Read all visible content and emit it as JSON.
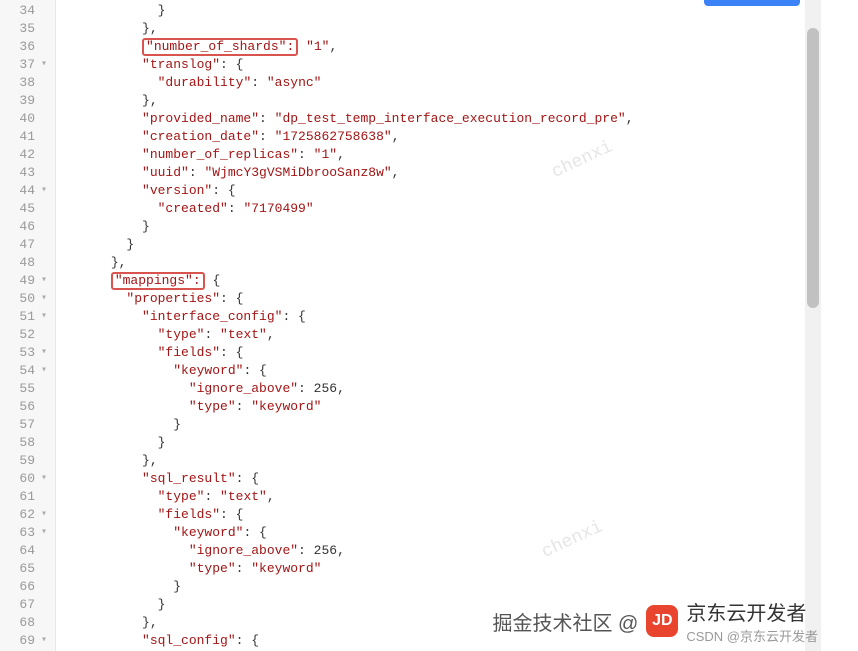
{
  "gutter": {
    "start": 34,
    "end": 69,
    "fold_lines": [
      37,
      44,
      49,
      50,
      51,
      53,
      54,
      60,
      62,
      63,
      69
    ]
  },
  "highlights": {
    "shards_key": "\"number_of_shards\":",
    "mappings_key": "\"mappings\":"
  },
  "code_lines": [
    {
      "n": 34,
      "indent": 12,
      "tokens": [
        {
          "t": "punc",
          "v": "}"
        }
      ]
    },
    {
      "n": 35,
      "indent": 10,
      "tokens": [
        {
          "t": "punc",
          "v": "},"
        }
      ]
    },
    {
      "n": 36,
      "indent": 10,
      "tokens": [
        {
          "t": "hl",
          "v": "\"number_of_shards\":"
        },
        {
          "t": "punc",
          "v": " "
        },
        {
          "t": "str",
          "v": "\"1\""
        },
        {
          "t": "punc",
          "v": ","
        }
      ]
    },
    {
      "n": 37,
      "indent": 10,
      "tokens": [
        {
          "t": "key",
          "v": "\"translog\""
        },
        {
          "t": "punc",
          "v": ": {"
        }
      ]
    },
    {
      "n": 38,
      "indent": 12,
      "tokens": [
        {
          "t": "key",
          "v": "\"durability\""
        },
        {
          "t": "punc",
          "v": ": "
        },
        {
          "t": "str",
          "v": "\"async\""
        }
      ]
    },
    {
      "n": 39,
      "indent": 10,
      "tokens": [
        {
          "t": "punc",
          "v": "},"
        }
      ]
    },
    {
      "n": 40,
      "indent": 10,
      "tokens": [
        {
          "t": "key",
          "v": "\"provided_name\""
        },
        {
          "t": "punc",
          "v": ": "
        },
        {
          "t": "str",
          "v": "\"dp_test_temp_interface_execution_record_pre\""
        },
        {
          "t": "punc",
          "v": ","
        }
      ]
    },
    {
      "n": 41,
      "indent": 10,
      "tokens": [
        {
          "t": "key",
          "v": "\"creation_date\""
        },
        {
          "t": "punc",
          "v": ": "
        },
        {
          "t": "str",
          "v": "\"1725862758638\""
        },
        {
          "t": "punc",
          "v": ","
        }
      ]
    },
    {
      "n": 42,
      "indent": 10,
      "tokens": [
        {
          "t": "key",
          "v": "\"number_of_replicas\""
        },
        {
          "t": "punc",
          "v": ": "
        },
        {
          "t": "str",
          "v": "\"1\""
        },
        {
          "t": "punc",
          "v": ","
        }
      ]
    },
    {
      "n": 43,
      "indent": 10,
      "tokens": [
        {
          "t": "key",
          "v": "\"uuid\""
        },
        {
          "t": "punc",
          "v": ": "
        },
        {
          "t": "str",
          "v": "\"WjmcY3gVSMiDbrooSanz8w\""
        },
        {
          "t": "punc",
          "v": ","
        }
      ]
    },
    {
      "n": 44,
      "indent": 10,
      "tokens": [
        {
          "t": "key",
          "v": "\"version\""
        },
        {
          "t": "punc",
          "v": ": {"
        }
      ]
    },
    {
      "n": 45,
      "indent": 12,
      "tokens": [
        {
          "t": "key",
          "v": "\"created\""
        },
        {
          "t": "punc",
          "v": ": "
        },
        {
          "t": "str",
          "v": "\"7170499\""
        }
      ]
    },
    {
      "n": 46,
      "indent": 10,
      "tokens": [
        {
          "t": "punc",
          "v": "}"
        }
      ]
    },
    {
      "n": 47,
      "indent": 8,
      "tokens": [
        {
          "t": "punc",
          "v": "}"
        }
      ]
    },
    {
      "n": 48,
      "indent": 6,
      "tokens": [
        {
          "t": "punc",
          "v": "},"
        }
      ]
    },
    {
      "n": 49,
      "indent": 6,
      "tokens": [
        {
          "t": "hl",
          "v": "\"mappings\":"
        },
        {
          "t": "punc",
          "v": " {"
        }
      ]
    },
    {
      "n": 50,
      "indent": 8,
      "tokens": [
        {
          "t": "key",
          "v": "\"properties\""
        },
        {
          "t": "punc",
          "v": ": {"
        }
      ]
    },
    {
      "n": 51,
      "indent": 10,
      "tokens": [
        {
          "t": "key",
          "v": "\"interface_config\""
        },
        {
          "t": "punc",
          "v": ": {"
        }
      ]
    },
    {
      "n": 52,
      "indent": 12,
      "tokens": [
        {
          "t": "key",
          "v": "\"type\""
        },
        {
          "t": "punc",
          "v": ": "
        },
        {
          "t": "str",
          "v": "\"text\""
        },
        {
          "t": "punc",
          "v": ","
        }
      ]
    },
    {
      "n": 53,
      "indent": 12,
      "tokens": [
        {
          "t": "key",
          "v": "\"fields\""
        },
        {
          "t": "punc",
          "v": ": {"
        }
      ]
    },
    {
      "n": 54,
      "indent": 14,
      "tokens": [
        {
          "t": "key",
          "v": "\"keyword\""
        },
        {
          "t": "punc",
          "v": ": {"
        }
      ]
    },
    {
      "n": 55,
      "indent": 16,
      "tokens": [
        {
          "t": "key",
          "v": "\"ignore_above\""
        },
        {
          "t": "punc",
          "v": ": "
        },
        {
          "t": "numv",
          "v": "256"
        },
        {
          "t": "punc",
          "v": ","
        }
      ]
    },
    {
      "n": 56,
      "indent": 16,
      "tokens": [
        {
          "t": "key",
          "v": "\"type\""
        },
        {
          "t": "punc",
          "v": ": "
        },
        {
          "t": "str",
          "v": "\"keyword\""
        }
      ]
    },
    {
      "n": 57,
      "indent": 14,
      "tokens": [
        {
          "t": "punc",
          "v": "}"
        }
      ]
    },
    {
      "n": 58,
      "indent": 12,
      "tokens": [
        {
          "t": "punc",
          "v": "}"
        }
      ]
    },
    {
      "n": 59,
      "indent": 10,
      "tokens": [
        {
          "t": "punc",
          "v": "},"
        }
      ]
    },
    {
      "n": 60,
      "indent": 10,
      "tokens": [
        {
          "t": "key",
          "v": "\"sql_result\""
        },
        {
          "t": "punc",
          "v": ": {"
        }
      ]
    },
    {
      "n": 61,
      "indent": 12,
      "tokens": [
        {
          "t": "key",
          "v": "\"type\""
        },
        {
          "t": "punc",
          "v": ": "
        },
        {
          "t": "str",
          "v": "\"text\""
        },
        {
          "t": "punc",
          "v": ","
        }
      ]
    },
    {
      "n": 62,
      "indent": 12,
      "tokens": [
        {
          "t": "key",
          "v": "\"fields\""
        },
        {
          "t": "punc",
          "v": ": {"
        }
      ]
    },
    {
      "n": 63,
      "indent": 14,
      "tokens": [
        {
          "t": "key",
          "v": "\"keyword\""
        },
        {
          "t": "punc",
          "v": ": {"
        }
      ]
    },
    {
      "n": 64,
      "indent": 16,
      "tokens": [
        {
          "t": "key",
          "v": "\"ignore_above\""
        },
        {
          "t": "punc",
          "v": ": "
        },
        {
          "t": "numv",
          "v": "256"
        },
        {
          "t": "punc",
          "v": ","
        }
      ]
    },
    {
      "n": 65,
      "indent": 16,
      "tokens": [
        {
          "t": "key",
          "v": "\"type\""
        },
        {
          "t": "punc",
          "v": ": "
        },
        {
          "t": "str",
          "v": "\"keyword\""
        }
      ]
    },
    {
      "n": 66,
      "indent": 14,
      "tokens": [
        {
          "t": "punc",
          "v": "}"
        }
      ]
    },
    {
      "n": 67,
      "indent": 12,
      "tokens": [
        {
          "t": "punc",
          "v": "}"
        }
      ]
    },
    {
      "n": 68,
      "indent": 10,
      "tokens": [
        {
          "t": "punc",
          "v": "},"
        }
      ]
    },
    {
      "n": 69,
      "indent": 10,
      "tokens": [
        {
          "t": "key",
          "v": "\"sql_config\""
        },
        {
          "t": "punc",
          "v": ": {"
        }
      ]
    }
  ],
  "watermarks": {
    "wm_diag": "chenxi",
    "brand_community": "掘金技术社区 @",
    "brand_name": "京东云开发者",
    "brand_sub": "CSDN @京东云开发者"
  }
}
